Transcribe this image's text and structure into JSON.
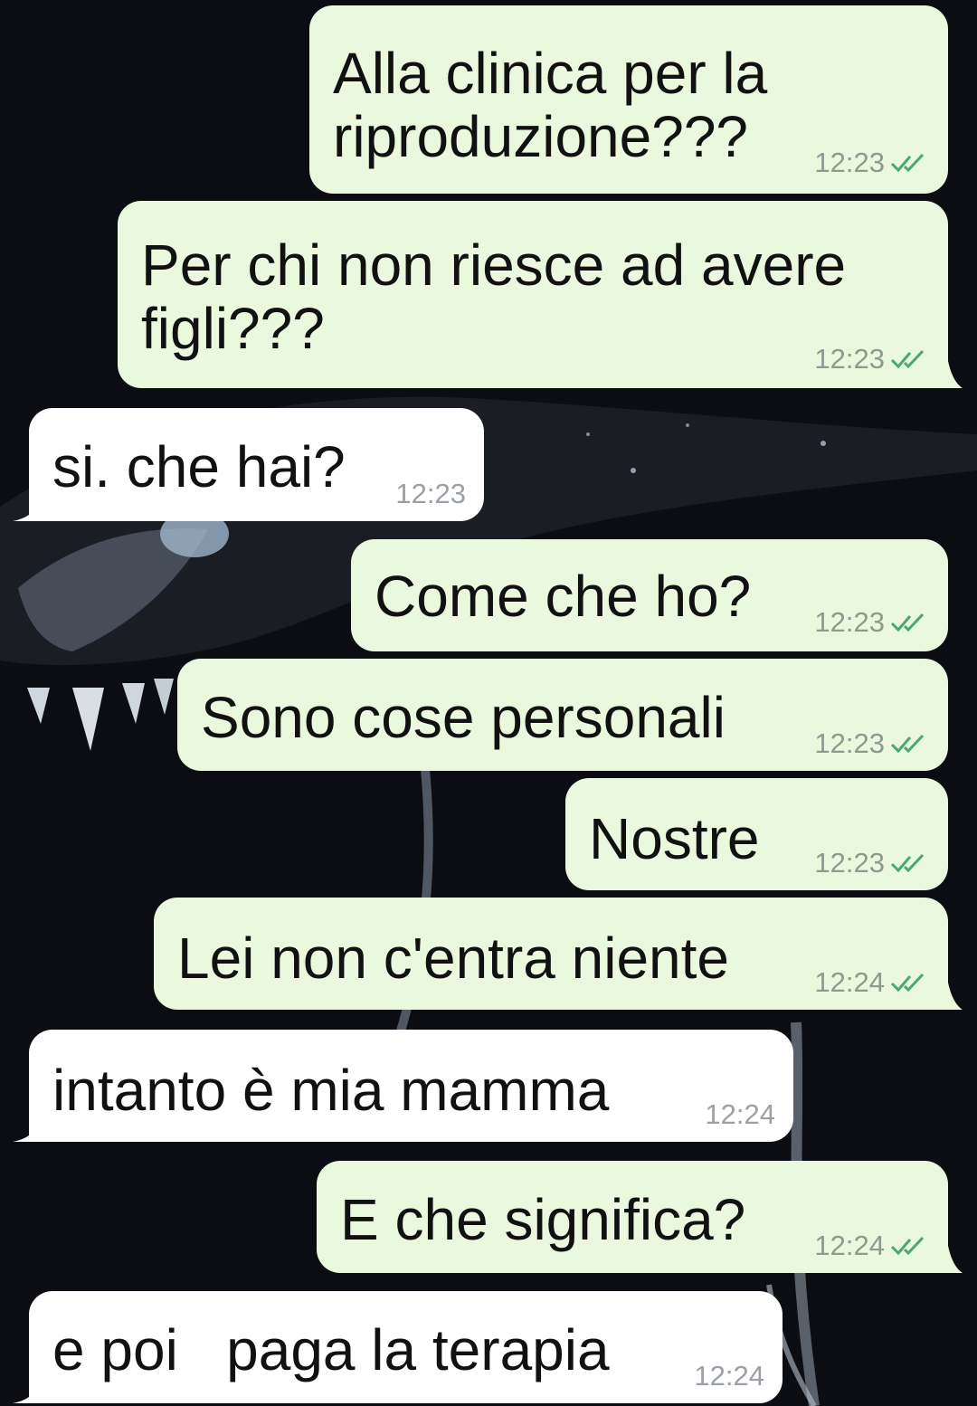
{
  "chat": {
    "messages": [
      {
        "dir": "out",
        "text": "Alla clinica per la\nriproduzione???",
        "time": "12:23",
        "status_icon": "double-check-icon"
      },
      {
        "dir": "out",
        "text": "Per chi non riesce ad avere\nfigli???",
        "time": "12:23",
        "status_icon": "double-check-icon"
      },
      {
        "dir": "in",
        "text": "si. che hai?",
        "time": "12:23"
      },
      {
        "dir": "out",
        "text": "Come che ho?",
        "time": "12:23",
        "status_icon": "double-check-icon"
      },
      {
        "dir": "out",
        "text": "Sono cose personali",
        "time": "12:23",
        "status_icon": "double-check-icon"
      },
      {
        "dir": "out",
        "text": "Nostre",
        "time": "12:23",
        "status_icon": "double-check-icon"
      },
      {
        "dir": "out",
        "text": "Lei non c'entra niente",
        "time": "12:24",
        "status_icon": "double-check-icon"
      },
      {
        "dir": "in",
        "text": "intanto è mia mamma",
        "time": "12:24"
      },
      {
        "dir": "out",
        "text": "E che significa?",
        "time": "12:24",
        "status_icon": "double-check-icon"
      },
      {
        "dir": "in",
        "text": "e poi   paga la terapia",
        "time": "12:24"
      }
    ]
  },
  "colors": {
    "outgoing_bubble": "#eaf8de",
    "incoming_bubble": "#ffffff",
    "read_ticks": "#4aa96c",
    "wallpaper": "#0b0d12"
  }
}
